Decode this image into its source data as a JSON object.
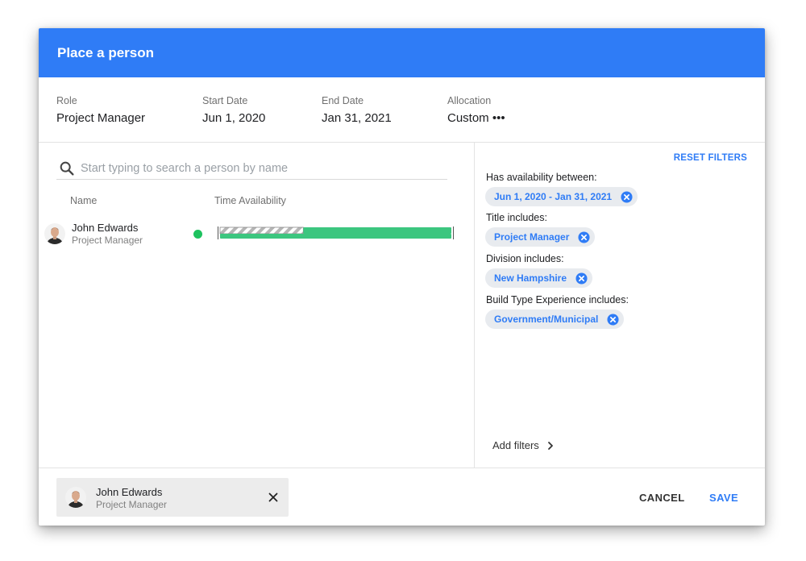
{
  "dialog": {
    "title": "Place a person"
  },
  "info": {
    "role": {
      "label": "Role",
      "value": "Project Manager"
    },
    "start": {
      "label": "Start Date",
      "value": "Jun 1, 2020"
    },
    "end": {
      "label": "End Date",
      "value": "Jan 31, 2021"
    },
    "allocation": {
      "label": "Allocation",
      "value": "Custom •••"
    }
  },
  "search": {
    "placeholder": "Start typing to search a person by name",
    "value": ""
  },
  "columns": {
    "name": "Name",
    "availability": "Time Availability"
  },
  "results": [
    {
      "name": "John Edwards",
      "role": "Project Manager",
      "status_color": "#1ec25f",
      "availability_start_fraction": 0.36
    }
  ],
  "filters": {
    "reset_label": "RESET FILTERS",
    "groups": [
      {
        "label": "Has availability between:",
        "chip": "Jun 1, 2020 - Jan 31, 2021"
      },
      {
        "label": "Title includes:",
        "chip": "Project Manager"
      },
      {
        "label": "Division includes:",
        "chip": "New Hampshire"
      },
      {
        "label": "Build Type Experience includes:",
        "chip": "Government/Municipal"
      }
    ],
    "add_label": "Add filters"
  },
  "selected": {
    "name": "John Edwards",
    "role": "Project Manager"
  },
  "actions": {
    "cancel": "CANCEL",
    "save": "SAVE"
  },
  "colors": {
    "accent": "#2f7cf6",
    "available": "#3cc67f",
    "status": "#1ec25f"
  },
  "icons": [
    "search-icon",
    "close-circle-icon",
    "chevron-right-icon",
    "close-icon",
    "avatar"
  ]
}
